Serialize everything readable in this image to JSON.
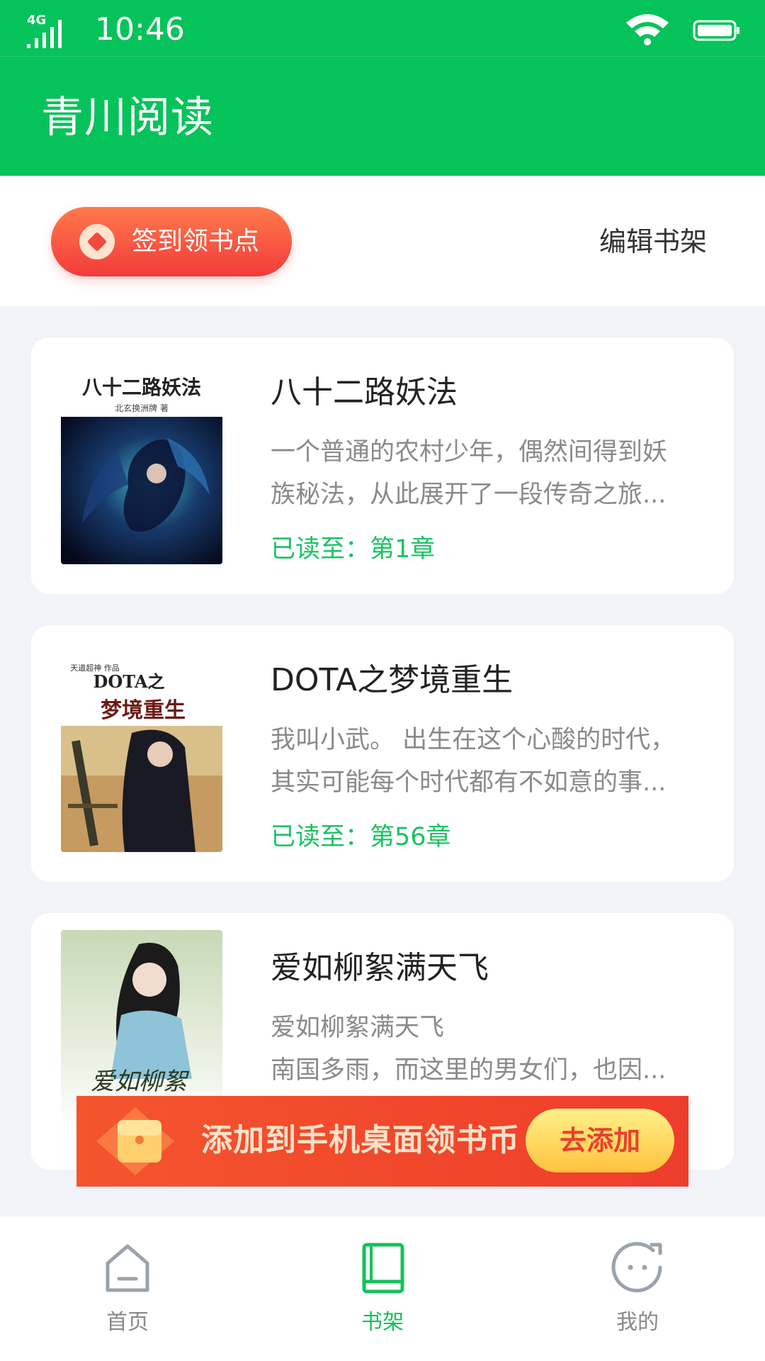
{
  "status_bar": {
    "network": "4G",
    "time": "10:46"
  },
  "header": {
    "title": "青川阅读"
  },
  "toolbar": {
    "sign_in_label": "签到领书点",
    "edit_label": "编辑书架"
  },
  "books": [
    {
      "title": "八十二路妖法",
      "desc_lines": [
        "一个普通的农村少年，偶然间得到妖",
        "族秘法，从此展开了一段传奇之旅..."
      ],
      "progress": "已读至：第1章",
      "cover_title": "八十二路妖法",
      "cover_author": "北玄换洲牌 著"
    },
    {
      "title": "DOTA之梦境重生",
      "desc_lines": [
        "我叫小武。 出生在这个心酸的时代，",
        "其实可能每个时代都有不如意的事..."
      ],
      "progress": "已读至：第56章",
      "cover_tagline": "天道超神 作品",
      "cover_title_top": "DOTA之",
      "cover_title_bottom": "梦境重生"
    },
    {
      "title": "爱如柳絮满天飞",
      "desc_lines": [
        "爱如柳絮满天飞",
        "南国多雨，而这里的男女们，也因..."
      ],
      "progress": "",
      "cover_title": "爱如柳絮"
    }
  ],
  "promo": {
    "text": "添加到手机桌面领书币",
    "button_label": "去添加"
  },
  "bottom_nav": [
    {
      "label": "首页",
      "icon": "home-icon",
      "active": false
    },
    {
      "label": "书架",
      "icon": "book-icon",
      "active": true
    },
    {
      "label": "我的",
      "icon": "profile-icon",
      "active": false
    }
  ],
  "colors": {
    "brand_green": "#05c35a",
    "progress_green": "#1ac363",
    "sign_red": "#f23b3b",
    "promo_red": "#ef3d2c",
    "page_bg": "#f1f3f8"
  }
}
